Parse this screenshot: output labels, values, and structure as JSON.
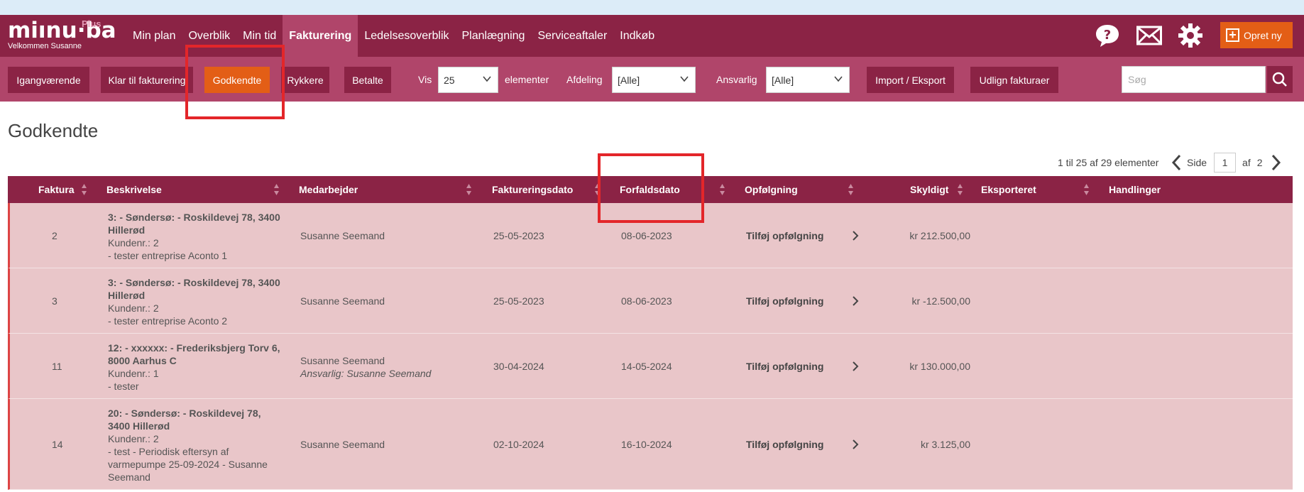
{
  "app": {
    "brand": "miınu·ba",
    "brand_plus": "Plus",
    "welcome": "Velkommen  Susanne"
  },
  "nav": {
    "items": [
      {
        "label": "Min plan"
      },
      {
        "label": "Overblik"
      },
      {
        "label": "Min tid"
      },
      {
        "label": "Fakturering",
        "active": true
      },
      {
        "label": "Ledelsesoverblik"
      },
      {
        "label": "Planlægning"
      },
      {
        "label": "Serviceaftaler"
      },
      {
        "label": "Indkøb"
      }
    ],
    "create_label": "Opret ny",
    "icons": [
      "help-icon",
      "mail-icon",
      "gear-icon",
      "plus-icon"
    ]
  },
  "subnav": {
    "tabs": [
      {
        "label": "Igangværende"
      },
      {
        "label": "Klar til fakturering"
      },
      {
        "label": "Godkendte",
        "active": true
      },
      {
        "label": "Rykkere"
      },
      {
        "label": "Betalte"
      }
    ],
    "vis_label": "Vis",
    "vis_value": "25",
    "elements_label": "elementer",
    "afdeling_label": "Afdeling",
    "afdeling_value": "[Alle]",
    "ansvarlig_label": "Ansvarlig",
    "ansvarlig_value": "[Alle]",
    "import_label": "Import / Eksport",
    "udlign_label": "Udlign fakturaer",
    "search_placeholder": "Søg"
  },
  "page": {
    "title": "Godkendte",
    "pager_info": "1 til 25 af 29 elementer",
    "side_label": "Side",
    "page_value": "1",
    "af_label": "af",
    "total_pages": "2"
  },
  "table": {
    "columns": [
      "Faktura",
      "Beskrivelse",
      "Medarbejder",
      "Faktureringsdato",
      "Forfaldsdato",
      "Opfølgning",
      "Skyldigt",
      "Eksporteret",
      "Handlinger"
    ],
    "rows": [
      {
        "faktura": "2",
        "title": "3: - Søndersø: - Roskildevej 78, 3400 Hillerød",
        "kunde": "Kundenr.: 2",
        "note": "- tester entreprise Aconto 1",
        "medarbejder": "Susanne Seemand",
        "ansvarlig": "",
        "faktureringsdato": "25-05-2023",
        "forfaldsdato": "08-06-2023",
        "opfolgning": "Tilføj opfølgning",
        "skyldigt": "kr 212.500,00"
      },
      {
        "faktura": "3",
        "title": "3: - Søndersø: - Roskildevej 78, 3400 Hillerød",
        "kunde": "Kundenr.: 2",
        "note": "- tester entreprise Aconto 2",
        "medarbejder": "Susanne Seemand",
        "ansvarlig": "",
        "faktureringsdato": "25-05-2023",
        "forfaldsdato": "08-06-2023",
        "opfolgning": "Tilføj opfølgning",
        "skyldigt": "kr -12.500,00"
      },
      {
        "faktura": "11",
        "title": "12: - xxxxxx: - Frederiksbjerg Torv 6, 8000 Aarhus C",
        "kunde": "Kundenr.: 1",
        "note": "- tester",
        "medarbejder": "Susanne Seemand",
        "ansvarlig": "Ansvarlig: Susanne Seemand",
        "faktureringsdato": "30-04-2024",
        "forfaldsdato": "14-05-2024",
        "opfolgning": "Tilføj opfølgning",
        "skyldigt": "kr 130.000,00"
      },
      {
        "faktura": "14",
        "title": "20: - Søndersø: - Roskildevej 78, 3400 Hillerød",
        "kunde": "Kundenr.: 2",
        "note": "- test - Periodisk eftersyn af varmepumpe 25-09-2024 - Susanne Seemand",
        "medarbejder": "Susanne Seemand",
        "ansvarlig": "",
        "faktureringsdato": "02-10-2024",
        "forfaldsdato": "16-10-2024",
        "opfolgning": "Tilføj opfølgning",
        "skyldigt": "kr 3.125,00"
      }
    ]
  },
  "colors": {
    "brand": "#8b2345",
    "brand_light": "#b0456a",
    "accent": "#e35e16",
    "row_bg": "#e9c6c9",
    "highlight": "#e3262a"
  }
}
